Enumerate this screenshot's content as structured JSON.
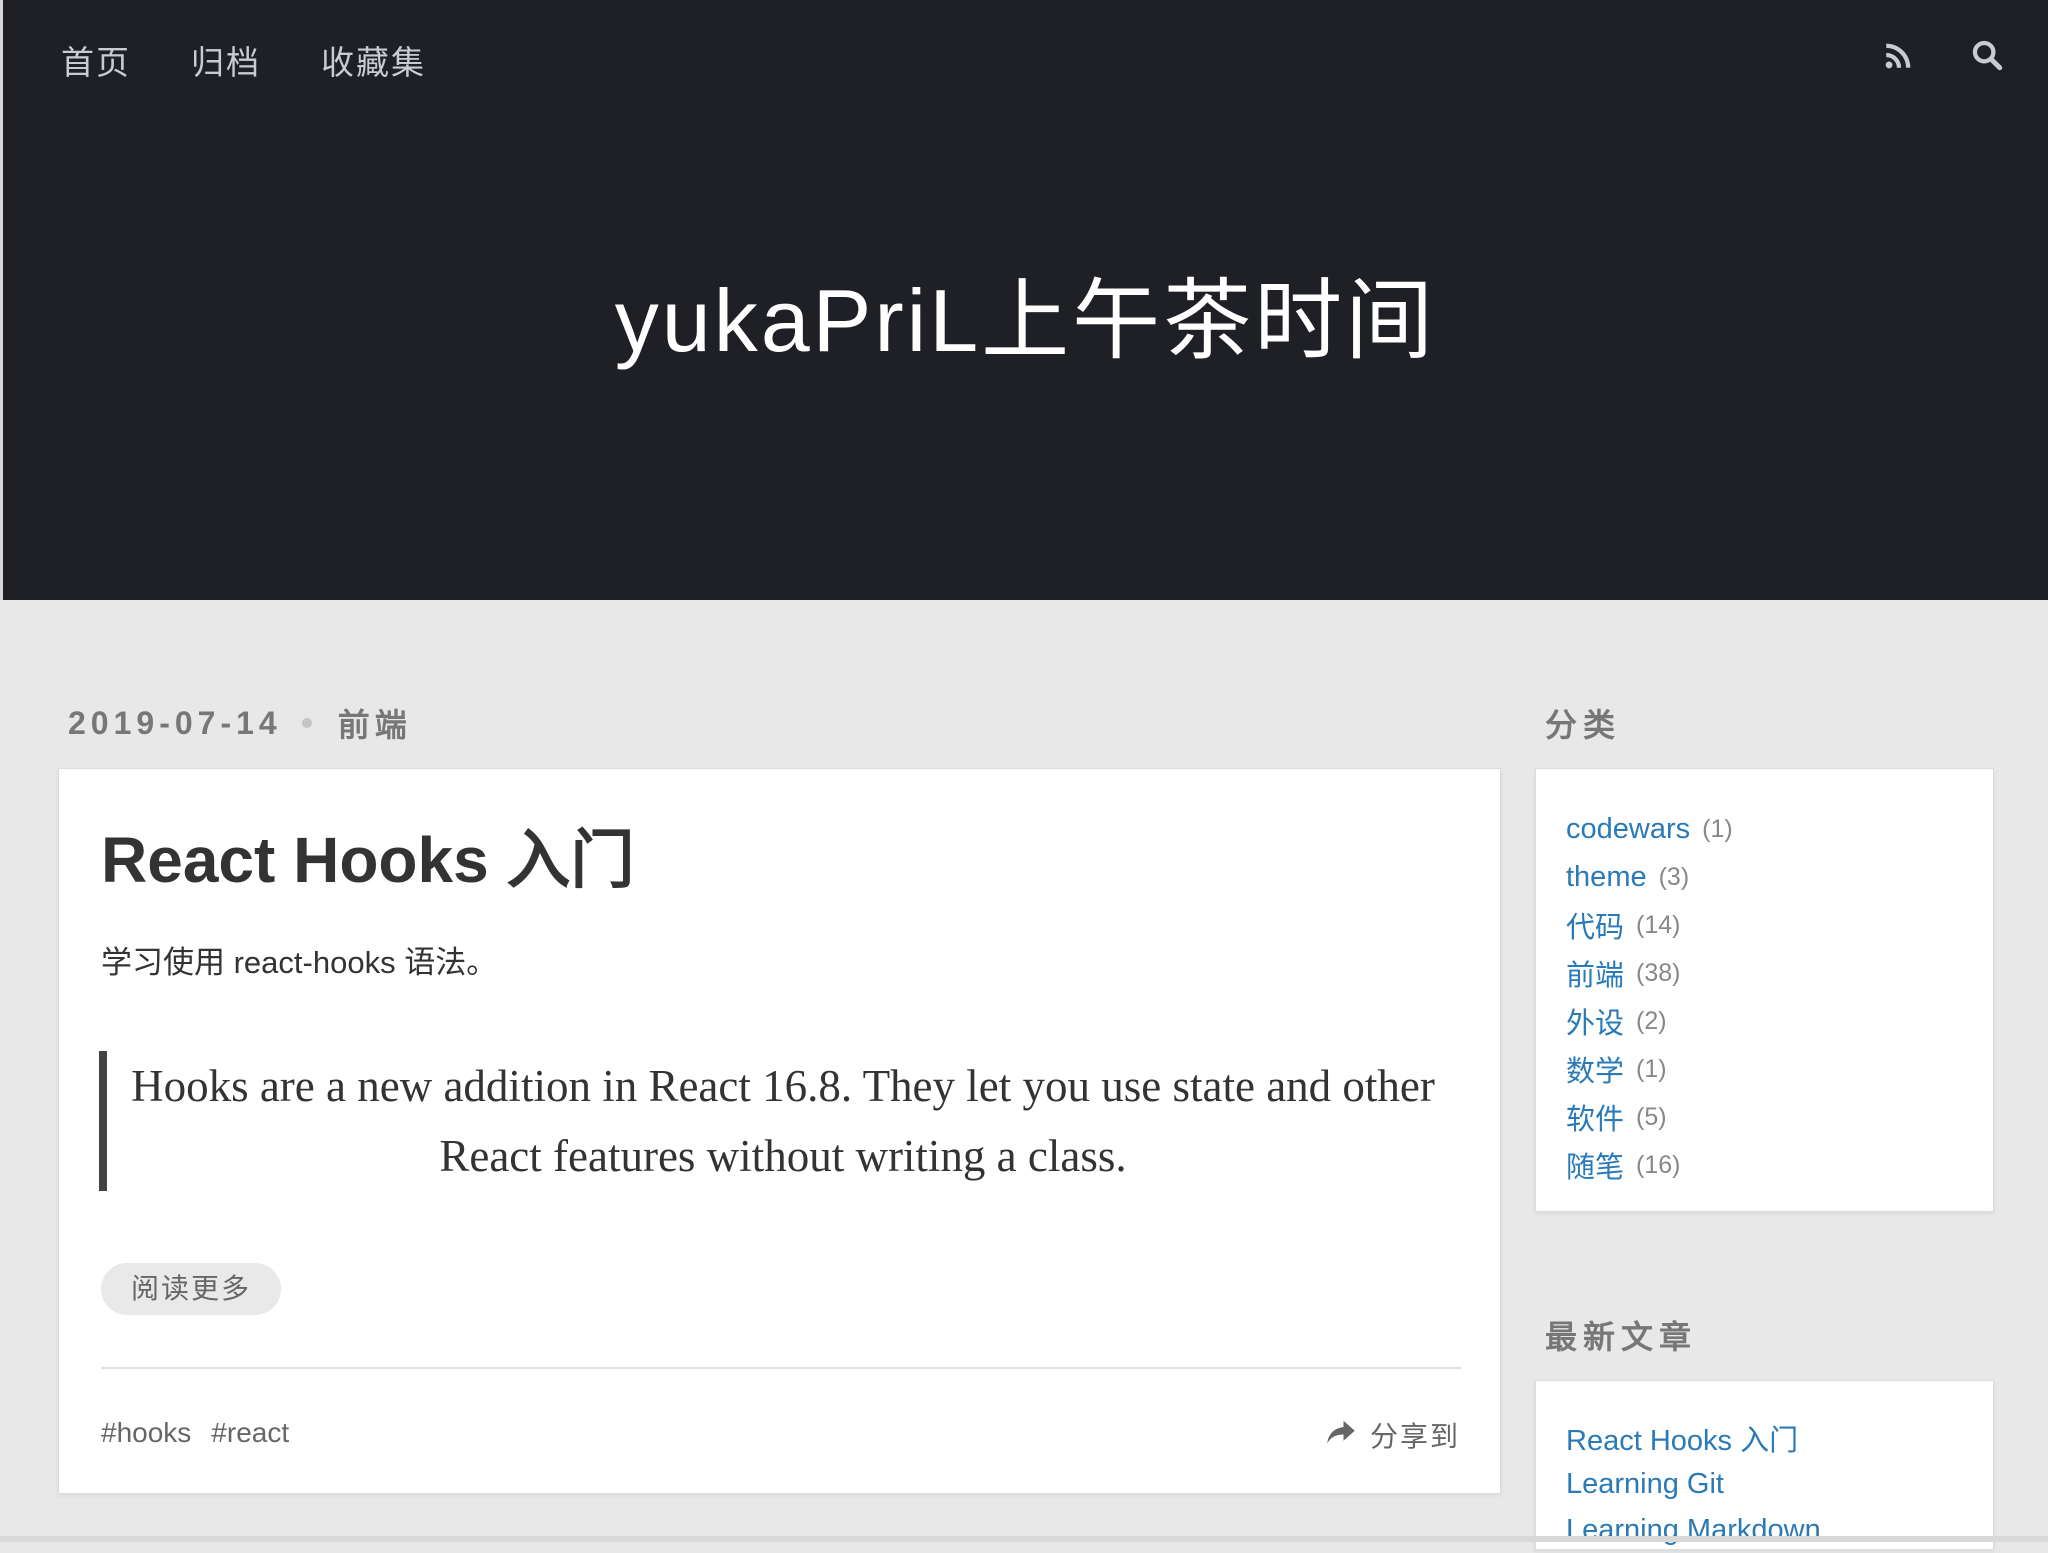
{
  "nav": {
    "items": [
      {
        "label": "首页"
      },
      {
        "label": "归档"
      },
      {
        "label": "收藏集"
      }
    ],
    "icons": [
      "rss-icon",
      "search-icon"
    ]
  },
  "site": {
    "title": "yukaPriL上午茶时间"
  },
  "post": {
    "date": "2019-07-14",
    "category": "前端",
    "title": "React Hooks 入门",
    "intro": "学习使用 react-hooks 语法。",
    "quote": "Hooks are a new addition in React 16.8. They let you use state and other React features without writing a class.",
    "read_more": "阅读更多",
    "tags": [
      "#hooks",
      "#react"
    ],
    "share": "分享到"
  },
  "sidebar": {
    "categories_title": "分类",
    "categories": [
      {
        "name": "codewars",
        "count": "(1)"
      },
      {
        "name": "theme",
        "count": "(3)"
      },
      {
        "name": "代码",
        "count": "(14)"
      },
      {
        "name": "前端",
        "count": "(38)"
      },
      {
        "name": "外设",
        "count": "(2)"
      },
      {
        "name": "数学",
        "count": "(1)"
      },
      {
        "name": "软件",
        "count": "(5)"
      },
      {
        "name": "随笔",
        "count": "(16)"
      }
    ],
    "recent_title": "最新文章",
    "recent": [
      {
        "title": "React Hooks 入门"
      },
      {
        "title": "Learning Git"
      },
      {
        "title": "Learning Markdown"
      }
    ]
  },
  "colors": {
    "header_bg": "#1f2026",
    "page_bg": "#e8e8e8",
    "link": "#2a7ab8"
  }
}
